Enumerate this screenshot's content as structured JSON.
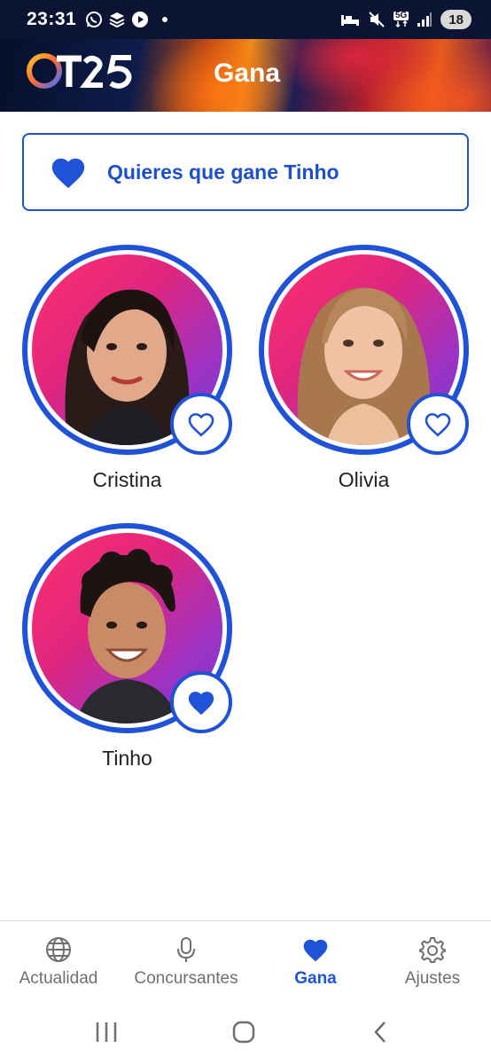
{
  "status_bar": {
    "time": "23:31",
    "left_icons": [
      "whatsapp-icon",
      "stack-icon",
      "play-icon",
      "dot-icon"
    ],
    "right_icons": [
      "bed-icon",
      "mute-icon",
      "5g-icon",
      "signal-icon"
    ],
    "network": "5G",
    "battery": "18"
  },
  "header": {
    "logo_text": "OT25",
    "title": "Gana"
  },
  "selected": {
    "icon": "heart-filled-icon",
    "text": "Quieres que gane Tinho"
  },
  "contestants": [
    {
      "name": "Cristina",
      "voted": false,
      "vote_icon": "heart-outline-icon"
    },
    {
      "name": "Olivia",
      "voted": false,
      "vote_icon": "heart-outline-icon"
    },
    {
      "name": "Tinho",
      "voted": true,
      "vote_icon": "heart-filled-icon"
    }
  ],
  "nav": {
    "items": [
      {
        "label": "Actualidad",
        "icon": "globe-icon",
        "active": false
      },
      {
        "label": "Concursantes",
        "icon": "microphone-icon",
        "active": false
      },
      {
        "label": "Gana",
        "icon": "heart-filled-icon",
        "active": true
      },
      {
        "label": "Ajustes",
        "icon": "gear-icon",
        "active": false
      }
    ]
  },
  "colors": {
    "accent": "#1f52d6",
    "header_dark": "#0b1433",
    "avatar_bg_start": "#ff2f6e",
    "avatar_bg_end": "#6d3cd0"
  }
}
